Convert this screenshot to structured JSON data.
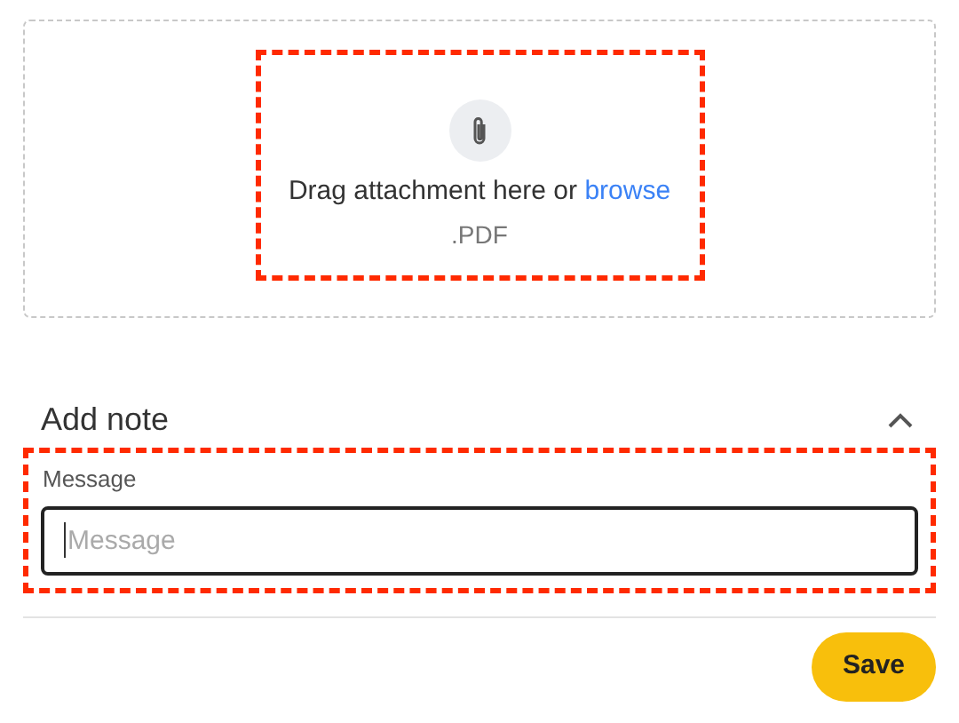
{
  "dropzone": {
    "prompt": "Drag attachment here or",
    "link": "browse",
    "formats": ".PDF",
    "highlighted": true
  },
  "note": {
    "title": "Add note",
    "expanded": true,
    "label": "Message",
    "placeholder": "Message",
    "highlighted": true
  },
  "buttons": [
    {
      "label": "Save"
    }
  ]
}
